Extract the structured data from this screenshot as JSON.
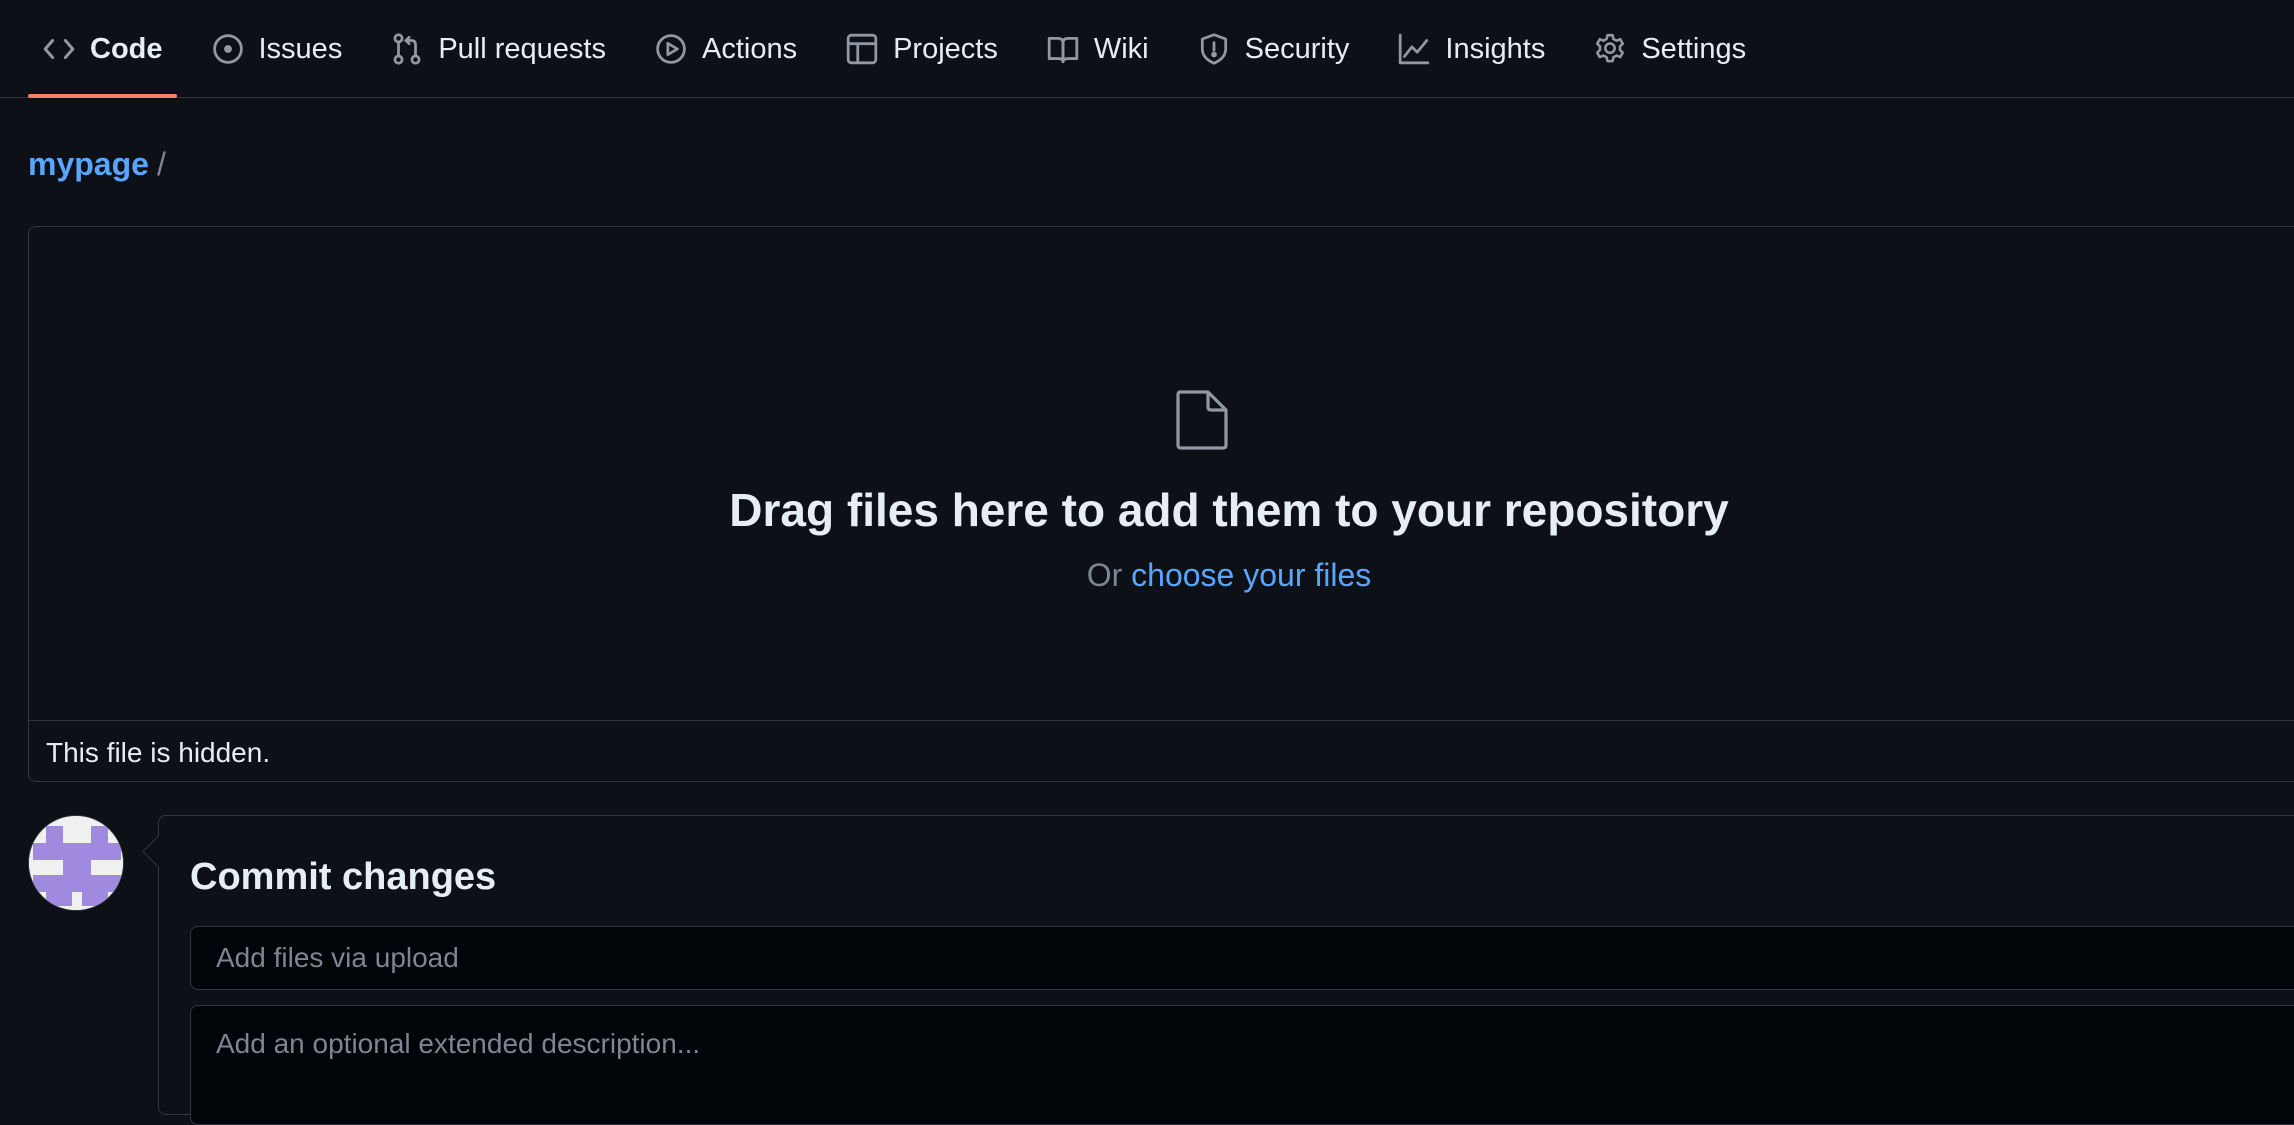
{
  "nav": {
    "tabs": [
      {
        "label": "Code",
        "icon": "code-icon",
        "selected": true
      },
      {
        "label": "Issues",
        "icon": "issue-opened-icon",
        "selected": false
      },
      {
        "label": "Pull requests",
        "icon": "git-pull-request-icon",
        "selected": false
      },
      {
        "label": "Actions",
        "icon": "play-icon",
        "selected": false
      },
      {
        "label": "Projects",
        "icon": "table-icon",
        "selected": false
      },
      {
        "label": "Wiki",
        "icon": "book-icon",
        "selected": false
      },
      {
        "label": "Security",
        "icon": "shield-icon",
        "selected": false
      },
      {
        "label": "Insights",
        "icon": "graph-icon",
        "selected": false
      },
      {
        "label": "Settings",
        "icon": "gear-icon",
        "selected": false
      }
    ]
  },
  "breadcrumb": {
    "repo": "mypage",
    "separator": "/"
  },
  "dropzone": {
    "icon": "file-icon",
    "title": "Drag files here to add them to your repository",
    "subtitle_prefix": "Or",
    "choose_link": "choose your files",
    "hidden_note": "This file is hidden."
  },
  "commit": {
    "avatar": "identicon-avatar",
    "title": "Commit changes",
    "summary_placeholder": "Add files via upload",
    "description_placeholder": "Add an optional extended description..."
  },
  "colors": {
    "background": "#0d1117",
    "border": "#30363d",
    "text": "#e6edf3",
    "muted": "#7d8590",
    "link": "#58a6ff",
    "tab_underline": "#f78166",
    "avatar_purple": "#a08ae0"
  }
}
